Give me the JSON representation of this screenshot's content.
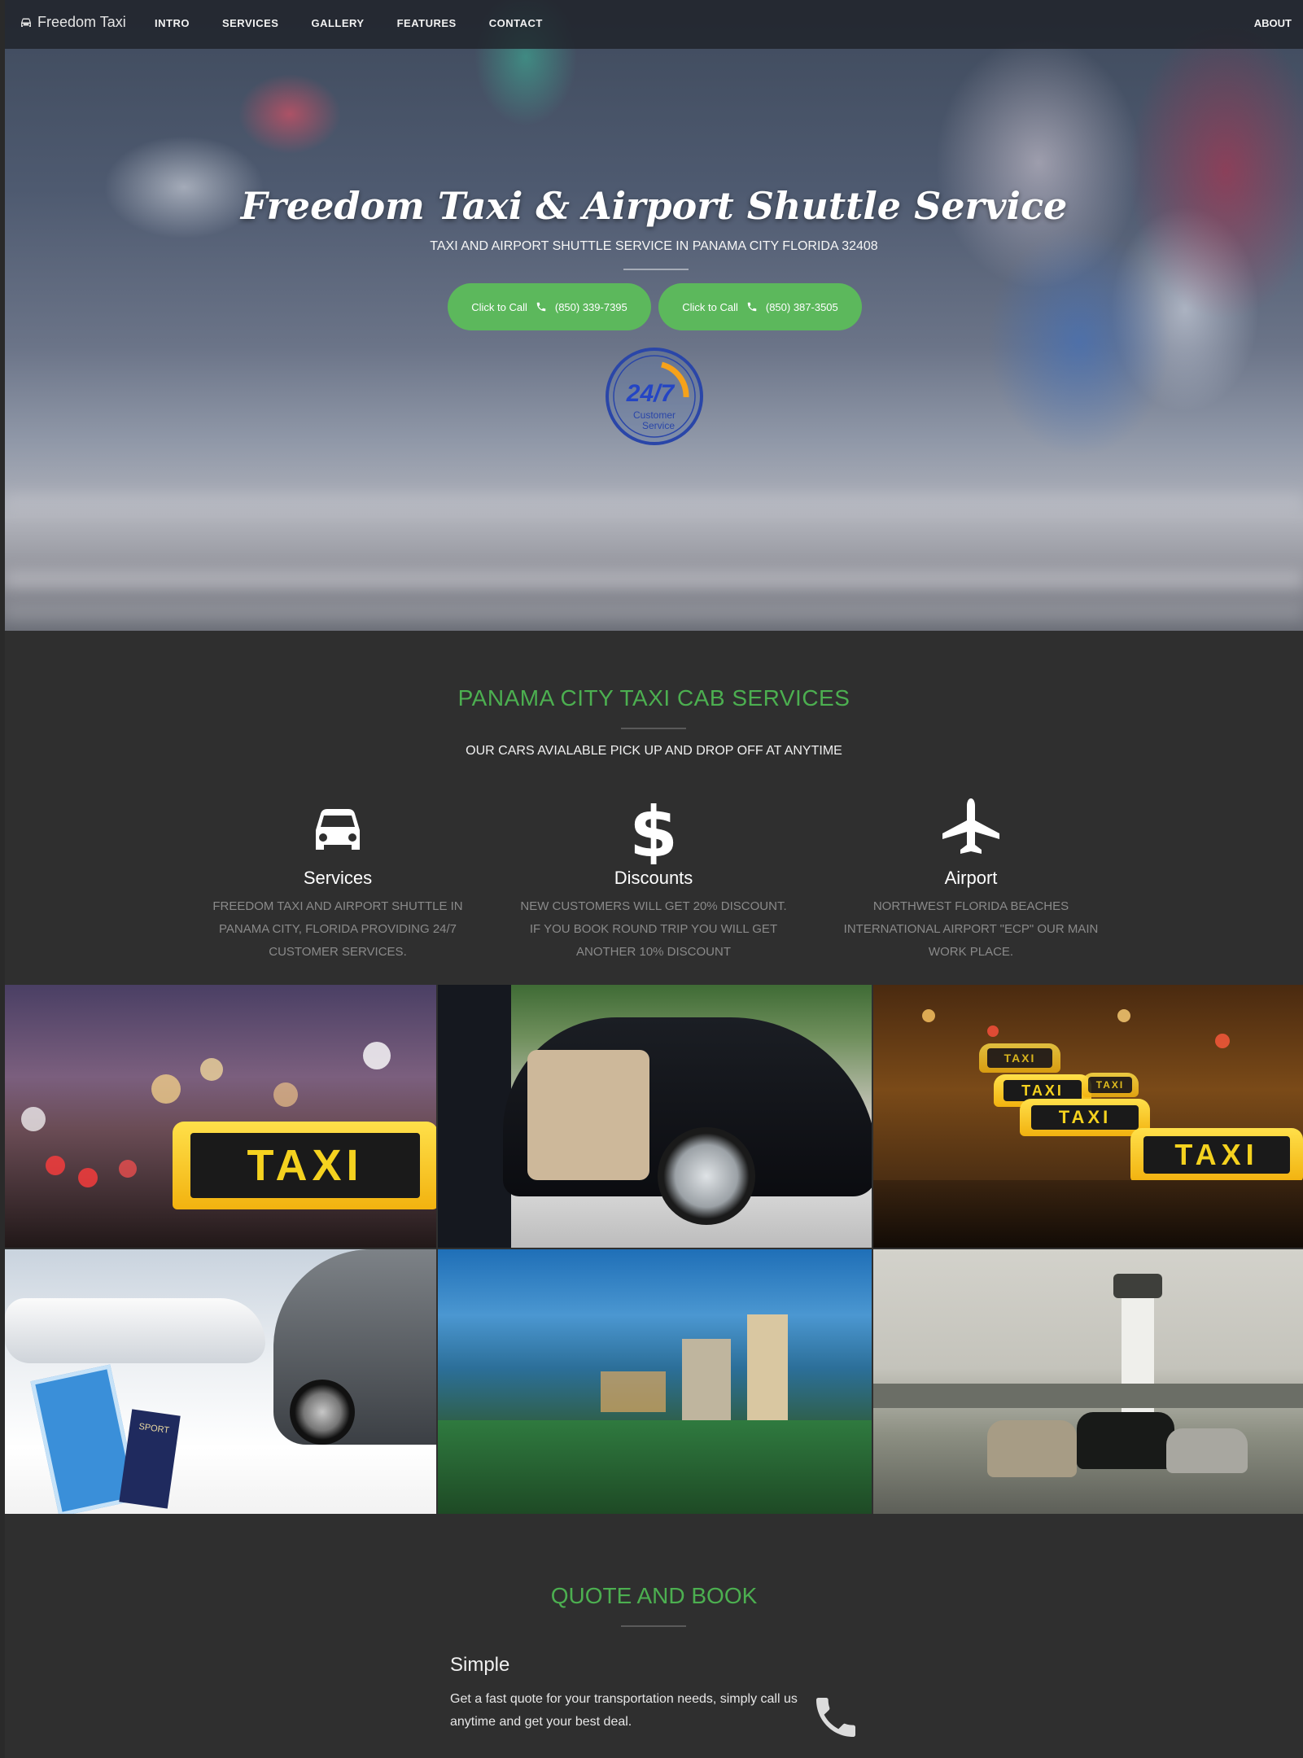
{
  "nav": {
    "brand": "Freedom Taxi",
    "links": [
      "INTRO",
      "SERVICES",
      "GALLERY",
      "FEATURES",
      "CONTACT"
    ],
    "right": "ABOUT"
  },
  "hero": {
    "title": "Freedom Taxi & Airport Shuttle Service",
    "subtitle": "TAXI AND AIRPORT SHUTTLE SERVICE IN PANAMA CITY FLORIDA 32408",
    "buttons": [
      {
        "label": "Click to Call",
        "phone": "(850) 339-7395"
      },
      {
        "label": "Click to Call",
        "phone": "(850) 387-3505"
      }
    ],
    "badge": {
      "top": "24/7",
      "line1": "Customer",
      "line2": "Service"
    }
  },
  "services": {
    "title": "PANAMA CITY TAXI CAB SERVICES",
    "subtitle": "OUR CARS AVIALABLE PICK UP AND DROP OFF AT ANYTIME",
    "items": [
      {
        "icon": "car-icon",
        "title": "Services",
        "lines": [
          "FREEDOM TAXI AND AIRPORT SHUTTLE IN",
          "PANAMA CITY, FLORIDA PROVIDING 24/7",
          "CUSTOMER SERVICES."
        ]
      },
      {
        "icon": "dollar-icon",
        "title": "Discounts",
        "lines": [
          "NEW CUSTOMERS WILL GET 20% DISCOUNT.",
          "IF YOU BOOK ROUND TRIP YOU WILL GET",
          "ANOTHER 10% DISCOUNT"
        ]
      },
      {
        "icon": "airplane-icon",
        "title": "Airport",
        "lines": [
          "NORTHWEST FLORIDA BEACHES",
          "INTERNATIONAL AIRPORT \"ECP\" OUR MAIN",
          "WORK PLACE."
        ]
      }
    ]
  },
  "gallery": {
    "sign_text": "TAXI",
    "passport_text": "SPORT"
  },
  "quote": {
    "title": "QUOTE AND BOOK",
    "heading": "Simple",
    "text": "Get a fast quote for your transportation needs, simply call us anytime and get your best deal."
  },
  "colors": {
    "accent_green": "#4caf50",
    "button_green": "#5cb85c",
    "section_bg": "#2f2f2f"
  }
}
